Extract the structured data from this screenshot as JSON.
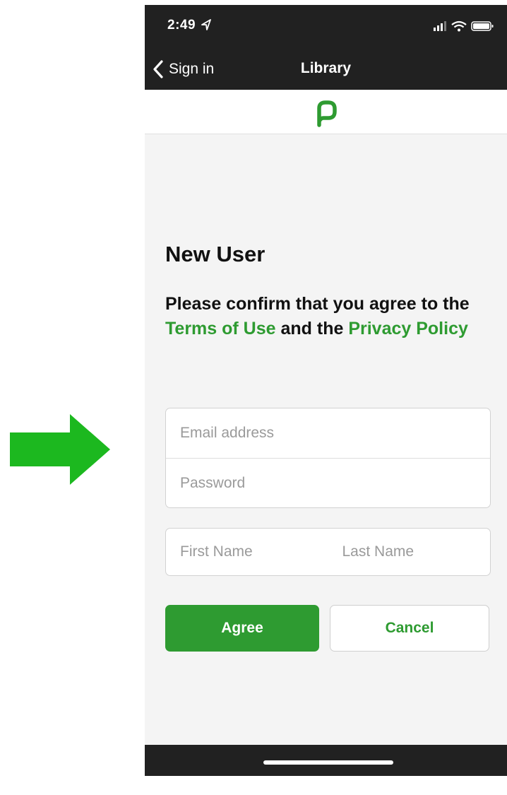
{
  "status_bar": {
    "time": "2:49"
  },
  "nav": {
    "back_label": "Sign in",
    "title": "Library"
  },
  "form": {
    "heading": "New User",
    "confirm_text": {
      "part1": "Please confirm that you agree to the ",
      "terms_link": "Terms of Use",
      "part2": " and the ",
      "privacy_link": "Privacy Policy"
    },
    "email_placeholder": "Email address",
    "password_placeholder": "Password",
    "first_name_placeholder": "First Name",
    "last_name_placeholder": "Last Name",
    "agree_label": "Agree",
    "cancel_label": "Cancel"
  },
  "colors": {
    "accent": "#2e9b31",
    "arrow": "#1cb81f",
    "bar_background": "#212121"
  },
  "icons": {
    "arrow": "right-arrow-icon",
    "logo": "libby-logo-icon",
    "back": "chevron-left-icon",
    "location": "location-arrow-icon",
    "signal": "signal-icon",
    "wifi": "wifi-icon",
    "battery": "battery-icon"
  }
}
